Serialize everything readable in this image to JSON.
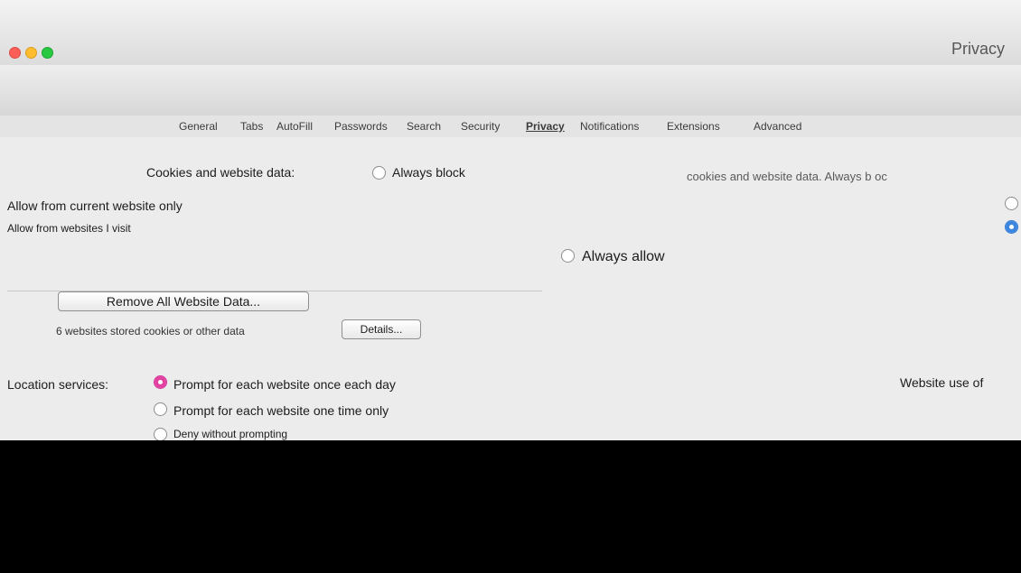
{
  "window": {
    "title": "Privacy"
  },
  "toolbar": {
    "items": [
      {
        "label": "General",
        "icon": "general-switch-icon"
      },
      {
        "label": "Tabs",
        "icon": "tabs-icon"
      },
      {
        "label": "AutoFill",
        "icon": "autofill-icon"
      },
      {
        "label": "Passwords",
        "icon": "passwords-key-icon"
      },
      {
        "label": "Search",
        "icon": "search-icon"
      },
      {
        "label": "Security",
        "icon": "shield-icon"
      },
      {
        "label": "Privacy",
        "icon": "hand-icon"
      },
      {
        "label": "Notifications",
        "icon": "bell-icon"
      },
      {
        "label": "Extensions",
        "icon": "puzzle-icon"
      },
      {
        "label": "Advanced",
        "icon": "gear-icon"
      }
    ]
  },
  "tabs": {
    "general": "General",
    "tabs": "Tabs",
    "autofill": "AutoFill",
    "passwords": "Passwords",
    "search": "Search",
    "security": "Security",
    "privacy": "Privacy",
    "notifications": "Notifications",
    "extensions": "Extensions",
    "advanced": "Advanced"
  },
  "cookies": {
    "section_label": "Cookies and website data:",
    "always_block": "Always block",
    "allow_current_only": "Allow from current website only",
    "allow_visited": "Allow from websites I visit",
    "always_allow": "Always allow",
    "help_text": "cookies and website data. Always b oc"
  },
  "website_data": {
    "remove_all_button": "Remove All Website Data...",
    "stored_text": "6 websites stored cookies or other data",
    "details_button": "Details..."
  },
  "location": {
    "label": "Location services:",
    "option_daily": "Prompt for each website once each day",
    "option_once": "Prompt for each website one time only",
    "option_deny": "Deny without prompting"
  },
  "website_tracking": {
    "label": "Website use of"
  }
}
